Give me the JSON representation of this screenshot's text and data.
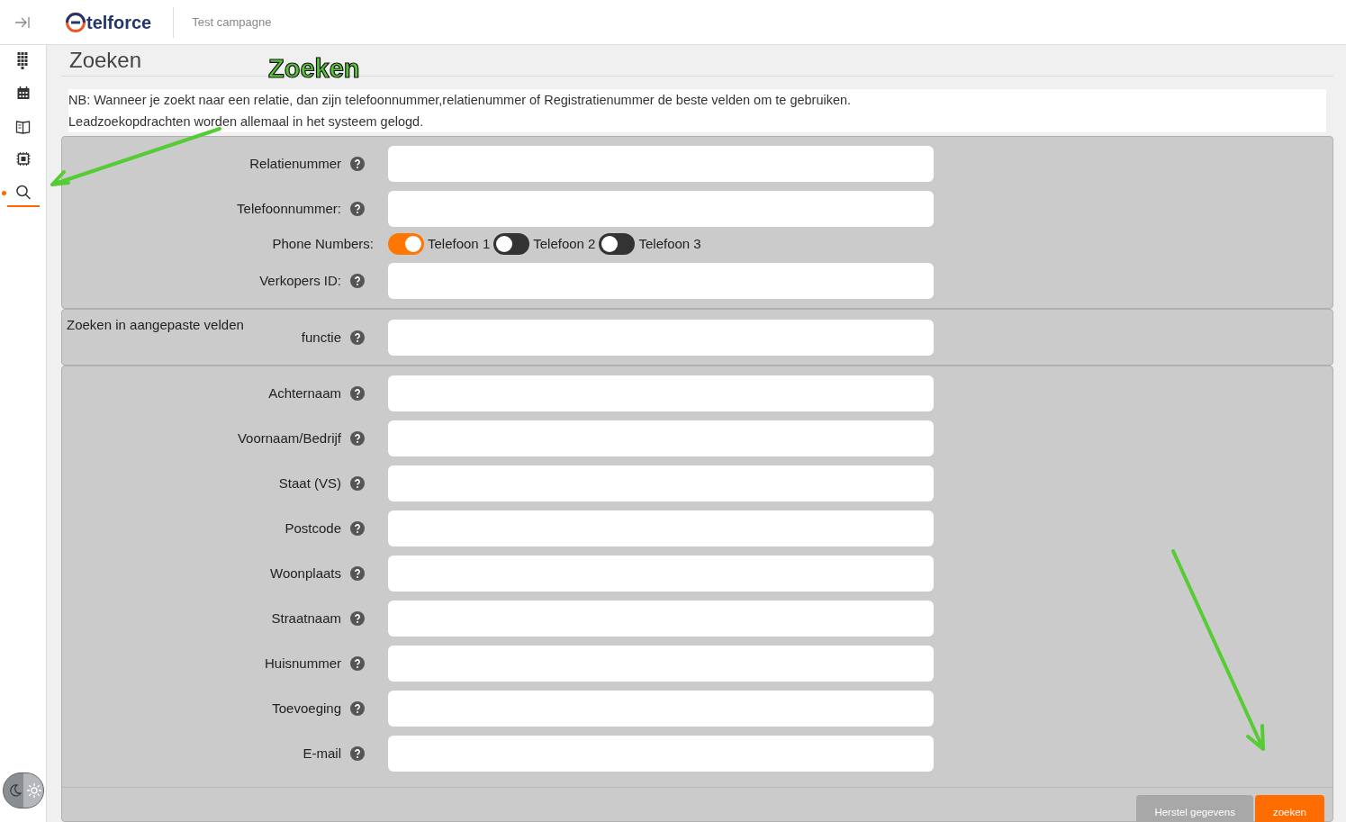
{
  "header": {
    "brand": "telforce",
    "campaign": "Test campagne"
  },
  "sidebar": {
    "items": [
      {
        "kind": "keypad",
        "selected": false
      },
      {
        "kind": "calendar",
        "selected": false
      },
      {
        "kind": "book",
        "selected": false
      },
      {
        "kind": "chip",
        "selected": false
      },
      {
        "kind": "search",
        "selected": true
      }
    ]
  },
  "page_title": "Zoeken",
  "notice": [
    "NB: Wanneer je zoekt naar een relatie, dan zijn telefoonnummer,relatienummer of Registratienummer de beste velden om te gebruiken.",
    "Leadzoekopdrachten worden allemaal in het systeem gelogd."
  ],
  "sections": [
    {
      "rows": [
        {
          "kind": "field",
          "label": "Relatienummer"
        },
        {
          "kind": "field",
          "label": "Telefoonnummer:"
        },
        {
          "kind": "toggles",
          "label": "Phone Numbers:",
          "options": [
            {
              "label": "Telefoon 1",
              "on": true
            },
            {
              "label": "Telefoon 2",
              "on": false
            },
            {
              "label": "Telefoon 3",
              "on": false
            }
          ]
        },
        {
          "kind": "field",
          "label": "Verkopers ID:"
        }
      ]
    },
    {
      "title": "Zoeken in aangepaste velden",
      "rows": [
        {
          "kind": "field",
          "label": "functie"
        }
      ]
    },
    {
      "rows": [
        {
          "kind": "field",
          "label": "Achternaam"
        },
        {
          "kind": "field",
          "label": "Voornaam/Bedrijf"
        },
        {
          "kind": "field",
          "label": "Staat (VS)"
        },
        {
          "kind": "field",
          "label": "Postcode"
        },
        {
          "kind": "field",
          "label": "Woonplaats"
        },
        {
          "kind": "field",
          "label": "Straatnaam"
        },
        {
          "kind": "field",
          "label": "Huisnummer"
        },
        {
          "kind": "field",
          "label": "Toevoeging"
        },
        {
          "kind": "field",
          "label": "E-mail"
        }
      ],
      "buttons": [
        {
          "kind": "secondary",
          "label": "Herstel gegevens"
        },
        {
          "kind": "primary",
          "label": "zoeken"
        }
      ]
    }
  ],
  "annotation": {
    "label": "Zoeken"
  }
}
